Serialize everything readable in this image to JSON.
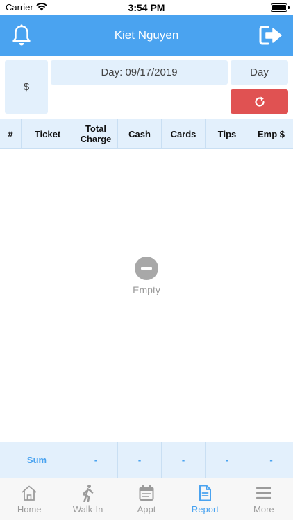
{
  "status_bar": {
    "carrier": "Carrier",
    "time": "3:54 PM"
  },
  "header": {
    "title": "Kiet Nguyen"
  },
  "filters": {
    "currency": "$",
    "date": "Day: 09/17/2019",
    "period": "Day"
  },
  "table": {
    "columns": [
      "#",
      "Ticket",
      "Total Charge",
      "Cash",
      "Cards",
      "Tips",
      "Emp $"
    ],
    "empty_text": "Empty"
  },
  "sum_row": {
    "label": "Sum",
    "values": [
      "-",
      "-",
      "-",
      "-",
      "-"
    ]
  },
  "tabs": [
    {
      "label": "Home",
      "icon": "home-icon"
    },
    {
      "label": "Walk-In",
      "icon": "walking-person-icon"
    },
    {
      "label": "Appt",
      "icon": "calendar-icon"
    },
    {
      "label": "Report",
      "icon": "document-icon",
      "active": true
    },
    {
      "label": "More",
      "icon": "menu-icon"
    }
  ],
  "colors": {
    "primary": "#4aa3f0",
    "panel": "#e3f0fc",
    "danger": "#e05252"
  }
}
